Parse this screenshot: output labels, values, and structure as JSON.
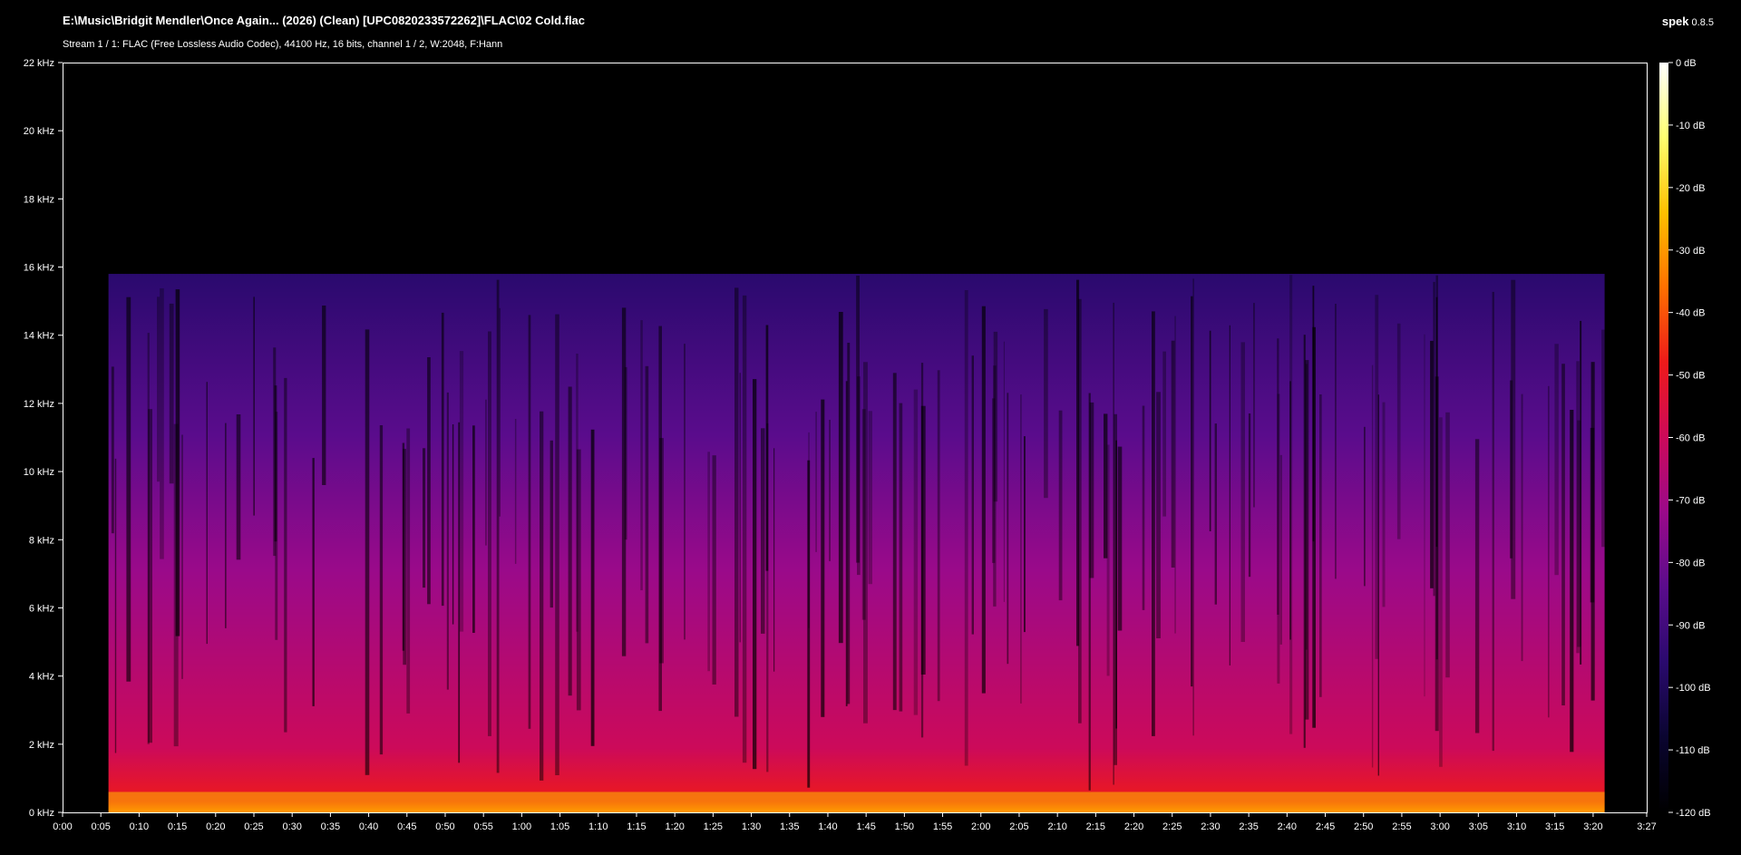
{
  "window": {
    "file_path": "E:\\Music\\Bridgit Mendler\\Once Again... (2026) (Clean) [UPC0820233572262]\\FLAC\\02 Cold.flac",
    "stream_info": "Stream 1 / 1: FLAC (Free Lossless Audio Codec), 44100 Hz, 16 bits, channel 1 / 2, W:2048, F:Hann",
    "app_name": "spek",
    "app_version": "0.8.5"
  },
  "chart_data": {
    "type": "heatmap",
    "title": "",
    "xlabel": "",
    "ylabel": "",
    "duration_seconds": 207,
    "freq_range_khz": [
      0,
      22
    ],
    "db_range": [
      -120,
      0
    ],
    "lowpass_cutoff_khz": 15.8,
    "signal_start_seconds": 6,
    "signal_end_seconds": 201.5,
    "x_ticks": [
      "0:00",
      "0:05",
      "0:10",
      "0:15",
      "0:20",
      "0:25",
      "0:30",
      "0:35",
      "0:40",
      "0:45",
      "0:50",
      "0:55",
      "1:00",
      "1:05",
      "1:10",
      "1:15",
      "1:20",
      "1:25",
      "1:30",
      "1:35",
      "1:40",
      "1:45",
      "1:50",
      "1:55",
      "2:00",
      "2:05",
      "2:10",
      "2:15",
      "2:20",
      "2:25",
      "2:30",
      "2:35",
      "2:40",
      "2:45",
      "2:50",
      "2:55",
      "3:00",
      "3:05",
      "3:10",
      "3:15",
      "3:20",
      "3:27"
    ],
    "y_ticks": [
      "0 kHz",
      "2 kHz",
      "4 kHz",
      "6 kHz",
      "8 kHz",
      "10 kHz",
      "12 kHz",
      "14 kHz",
      "16 kHz",
      "18 kHz",
      "20 kHz",
      "22 kHz"
    ],
    "db_ticks": [
      "0 dB",
      "-10 dB",
      "-20 dB",
      "-30 dB",
      "-40 dB",
      "-50 dB",
      "-60 dB",
      "-70 dB",
      "-80 dB",
      "-90 dB",
      "-100 dB",
      "-110 dB",
      "-120 dB"
    ],
    "colormap": [
      "#000000",
      "#0a0530",
      "#2a0a6e",
      "#5a0c8c",
      "#9a0a8a",
      "#cc0a5a",
      "#ee1a1a",
      "#ff7000",
      "#ffc000",
      "#ffff70",
      "#ffffff"
    ]
  }
}
